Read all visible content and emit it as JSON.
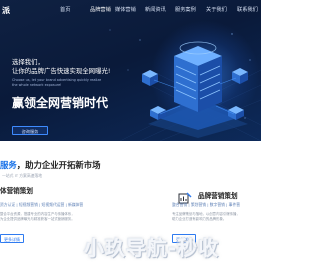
{
  "nav": {
    "logo_fragment": "派",
    "items": [
      {
        "label": "首页"
      },
      {
        "label": "品牌营销"
      },
      {
        "label": "媒体营销"
      },
      {
        "label": "新闻资讯"
      },
      {
        "label": "服务案例"
      },
      {
        "label": "关于我们"
      },
      {
        "label": "联系我们"
      }
    ],
    "active_index": 1,
    "accent_color": "#3e8bff"
  },
  "hero": {
    "line1": "选择我们，",
    "line2": "让你的品牌广告快速实现全网曝光!",
    "en_line1": "Choose us, let your brand advertising quickly realize",
    "en_line2": "the whole network exposure!",
    "headline": "赢领全网营销时代",
    "button_label": "咨询服务",
    "illustration": "server-cube-isometric-icon"
  },
  "section": {
    "title_accent": "服务",
    "title_rest": "，助力企业开拓新市场",
    "subtitle": "一站式 IT 方案高速落地"
  },
  "left_card": {
    "title": "体营销策划",
    "tags": "资方认证 | 短视频营销 | 短视频代运营 | 新媒体营",
    "desc_line1": "整合平台资源，搭建专业的内容生产与传播体系，",
    "desc_line2": "为企业提供品牌曝光与精准获客一站式营销服务。",
    "button_label": "更多详情"
  },
  "right_card": {
    "icon": "chart-pen-icon",
    "title": "品牌营销策划",
    "tags": "整合营销 | 策划营销 | 数字营销 | 事件营",
    "desc_line1": "专注品牌策划与落地，以创意内容引爆传播，",
    "desc_line2": "助力企业打造有影响力的品牌形象。",
    "button_label": "更多详情"
  },
  "watermark": {
    "text": "小玖导航-秒收"
  }
}
